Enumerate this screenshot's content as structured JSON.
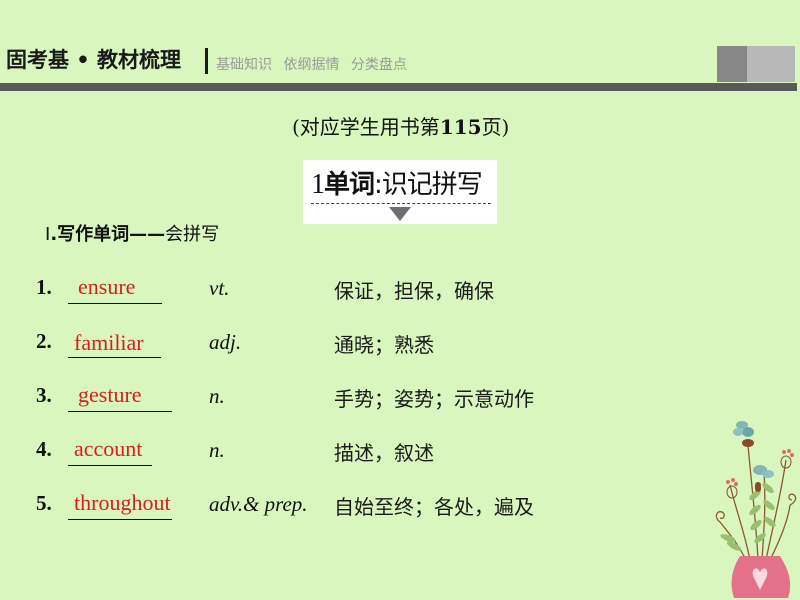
{
  "header": {
    "title": "固考基 • 教材梳理",
    "subtitles": [
      "基础知识",
      "依纲据情",
      "分类盘点"
    ]
  },
  "page_reference": {
    "prefix": "(对应学生用书第",
    "page": "115",
    "suffix": "页)"
  },
  "section": {
    "number": "1",
    "bold_label": "单词",
    "separator": ":",
    "label": "识记拼写"
  },
  "subheading": {
    "roman": "Ⅰ",
    "bold_text": ".写作单词——",
    "text": "会拼写"
  },
  "words": [
    {
      "index": "1.",
      "answer": "ensure",
      "pos": "vt.",
      "meaning": "保证，担保，确保"
    },
    {
      "index": "2.",
      "answer": "familiar",
      "pos": "adj.",
      "meaning": "通晓；熟悉"
    },
    {
      "index": "3.",
      "answer": "gesture",
      "pos": "n.",
      "meaning": "手势；姿势；示意动作"
    },
    {
      "index": "4.",
      "answer": "account",
      "pos": "n.",
      "meaning": "描述，叙述"
    },
    {
      "index": "5.",
      "answer": "throughout",
      "pos": "adv.& prep.",
      "meaning": "自始至终；各处，遍及"
    }
  ],
  "colors": {
    "background": "#d9f6be",
    "answer": "#d42020",
    "header_bar": "#595959"
  }
}
